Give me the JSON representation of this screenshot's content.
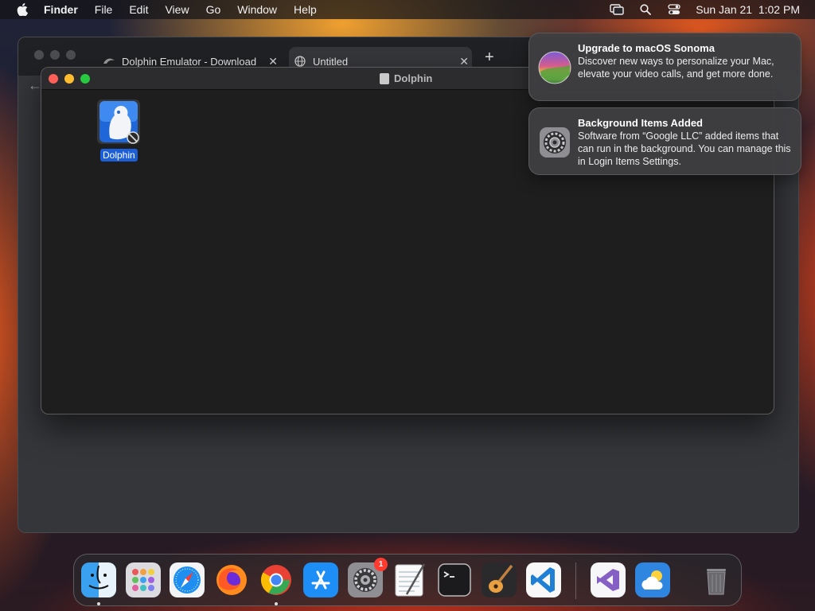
{
  "menubar": {
    "app_name": "Finder",
    "items": [
      "File",
      "Edit",
      "View",
      "Go",
      "Window",
      "Help"
    ],
    "clock": "Sun Jan 21  1:02 PM"
  },
  "browser": {
    "tabs": [
      {
        "title": "Dolphin Emulator - Download"
      },
      {
        "title": "Untitled"
      }
    ],
    "new_tab_symbol": "+",
    "close_symbol": "✕",
    "back_symbol": "←"
  },
  "finder": {
    "title": "Dolphin",
    "file": {
      "name": "Dolphin",
      "icon": "dolphin-app-icon"
    }
  },
  "notifications": [
    {
      "title": "Upgrade to macOS Sonoma",
      "body": "Discover new ways to personalize your Mac, elevate your video calls, and get more done.",
      "icon": "macos-sonoma-icon"
    },
    {
      "title": "Background Items Added",
      "body": "Software from “Google LLC” added items that can run in the background. You can manage this in Login Items Settings.",
      "icon": "system-settings-icon"
    }
  ],
  "dock": {
    "apps": [
      "Finder",
      "Launchpad",
      "Safari",
      "Firefox",
      "Google Chrome",
      "App Store",
      "System Settings",
      "TextEdit",
      "Terminal",
      "GarageBand",
      "Visual Studio Code",
      "Visual Studio",
      "Weather",
      "Trash"
    ],
    "system_settings_badge": "1"
  }
}
